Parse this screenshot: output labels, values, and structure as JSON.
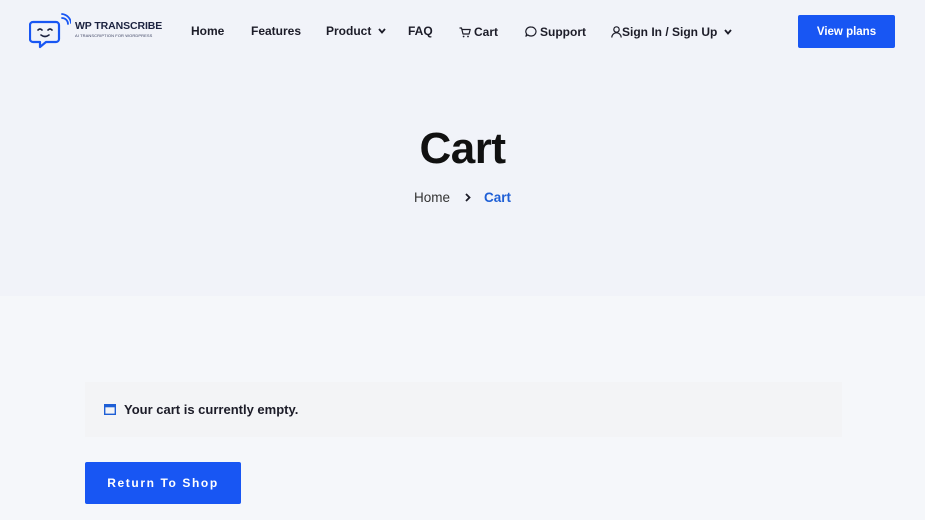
{
  "brand": {
    "name": "WP TRANSCRIBE",
    "tagline": "AI TRANSCRIPTION FOR WORDPRESS",
    "logo_icon": "chat-bubble-face-icon",
    "accent": "#1856f3"
  },
  "nav": {
    "home": "Home",
    "features": "Features",
    "product": "Product",
    "faq": "FAQ",
    "cart": "Cart",
    "support": "Support",
    "account": "Sign In / Sign Up",
    "cta": "View plans"
  },
  "page": {
    "title": "Cart",
    "breadcrumb": {
      "home": "Home",
      "current": "Cart"
    }
  },
  "cart": {
    "empty_message": "Your cart is currently empty.",
    "return_button": "Return To Shop"
  }
}
